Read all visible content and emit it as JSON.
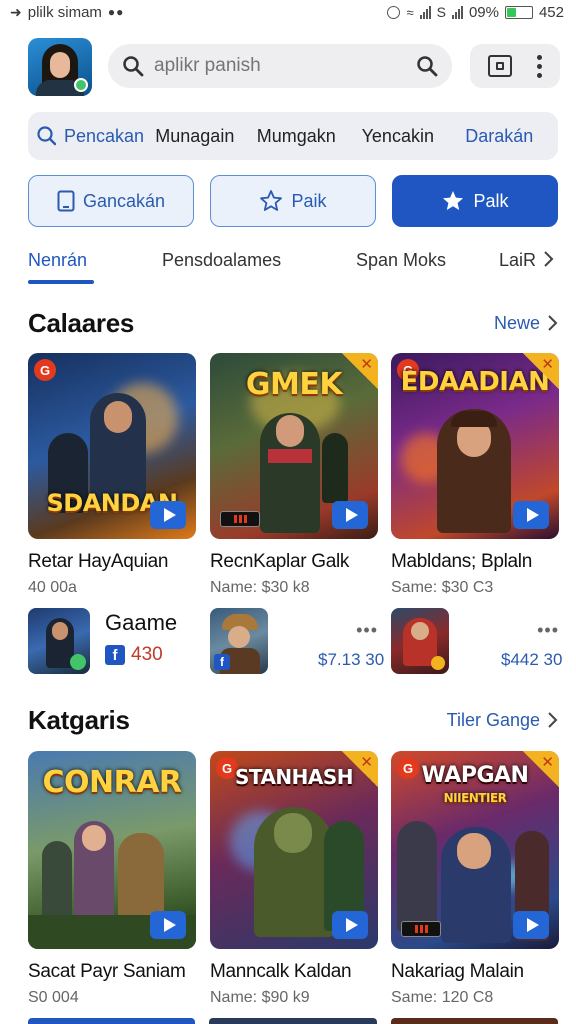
{
  "status_bar": {
    "left_text": "plilk simam",
    "battery_percent": "09%",
    "clock": "452",
    "battery_level": 0.35
  },
  "header": {
    "search_placeholder": "aplikr panish"
  },
  "filter_bar": {
    "items": [
      "Pencakan",
      "Munagain",
      "Mumgakn",
      "Yencakin",
      "Darakán"
    ]
  },
  "buttons": {
    "left": "Gancakán",
    "middle": "Paik",
    "right": "Palk"
  },
  "tabs": {
    "items": [
      "Nenrán",
      "Pensdoalames",
      "Span Moks",
      "LaiR"
    ]
  },
  "section1": {
    "title": "Calaares",
    "link": "Newe",
    "cards": [
      {
        "art_title": "SDANDAN",
        "title": "Retar HayAquian",
        "sub": "40 00a"
      },
      {
        "art_title": "GMEK",
        "title": "RecnKaplar Galk",
        "sub": "Name: $30 k8"
      },
      {
        "art_title": "EDAADIAN",
        "title": "Mabldans; Bplaln",
        "sub": "Same: $30 C3"
      }
    ],
    "minis": [
      {
        "name": "Gaame",
        "count": "430"
      },
      {
        "price": "$7.13 30"
      },
      {
        "price": "$442 30"
      }
    ]
  },
  "section2": {
    "title": "Katgaris",
    "link": "Tiler Gange",
    "cards": [
      {
        "art_title": "CONRAR",
        "title": "Sacat Payr Saniam",
        "sub": "S0 004"
      },
      {
        "art_title": "STANHASH",
        "title": "Manncalk Kaldan",
        "sub": "Name: $90 k9"
      },
      {
        "art_title": "WAPGAN",
        "art_sub": "NIIENTIER",
        "title": "Nakariag Malain",
        "sub": "Same: 120 C8"
      }
    ]
  },
  "colors": {
    "accent": "#1f56c2",
    "link": "#2a5bb0",
    "badge_orange": "#f3b321",
    "online_green": "#43c466"
  },
  "icons": {
    "search": "search-icon",
    "star": "star-icon",
    "tablet": "tablet-icon",
    "chevron": "chevron-right-icon",
    "play": "play-icon",
    "facebook": "facebook-icon",
    "kebab": "more-vertical-icon"
  }
}
